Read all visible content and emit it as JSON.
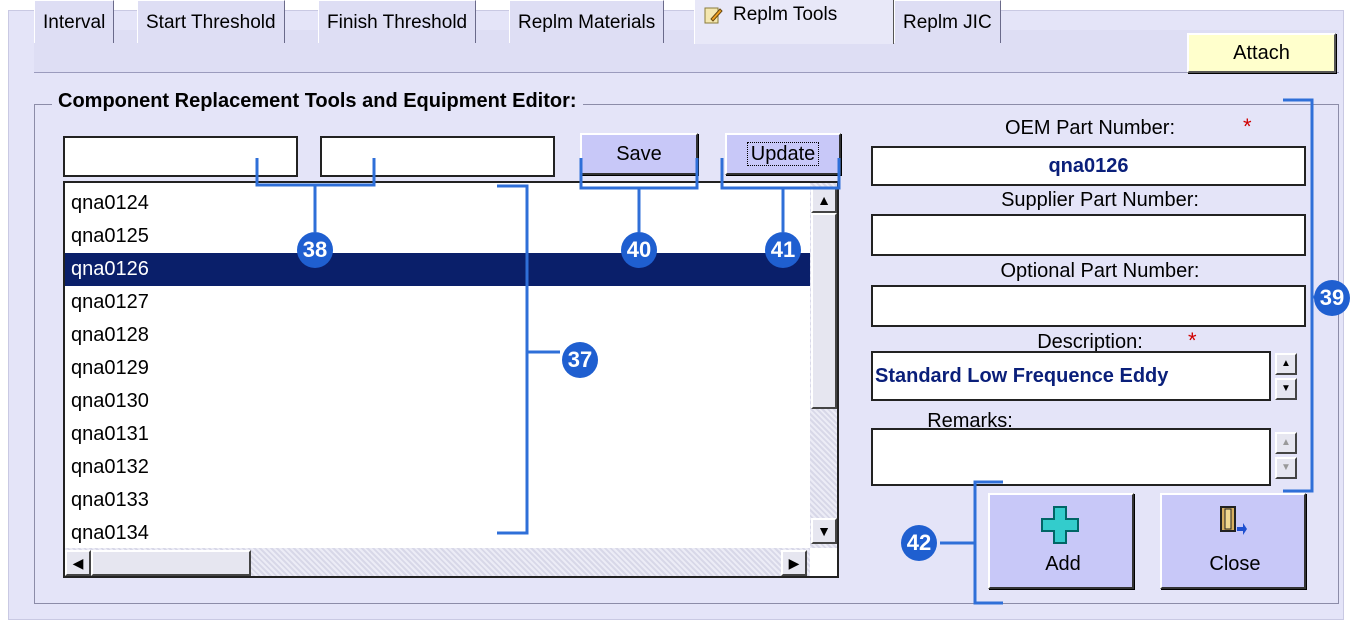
{
  "tabs": [
    {
      "label": "Interval"
    },
    {
      "label": "Start Threshold"
    },
    {
      "label": "Finish Threshold"
    },
    {
      "label": "Replm Materials"
    },
    {
      "label": "Replm Tools",
      "active": true,
      "icon": "pencil-note-icon"
    },
    {
      "label": "Replm JIC"
    }
  ],
  "attach_label": "Attach",
  "group_title": "Component Replacement Tools and Equipment Editor:",
  "filters": {
    "field1": "",
    "field2": ""
  },
  "save_label": "Save",
  "update_label": "Update",
  "list": {
    "items": [
      "qna0124",
      "qna0125",
      "qna0126",
      "qna0127",
      "qna0128",
      "qna0129",
      "qna0130",
      "qna0131",
      "qna0132",
      "qna0133",
      "qna0134"
    ],
    "selected_index": 2
  },
  "form": {
    "oem_label": "OEM Part Number:",
    "oem_value": "qna0126",
    "supplier_label": "Supplier Part Number:",
    "supplier_value": "",
    "optional_label": "Optional Part Number:",
    "optional_value": "",
    "description_label": "Description:",
    "description_value": "Standard Low Frequence Eddy",
    "remarks_label": "Remarks:",
    "remarks_value": "",
    "required_mark": "*"
  },
  "add_label": "Add",
  "close_label": "Close",
  "callouts": [
    "37",
    "38",
    "39",
    "40",
    "41",
    "42"
  ],
  "colors": {
    "accent": "#2f6fd8",
    "selection": "#0a1f6a",
    "button": "#c8c8f8",
    "attach": "#ffffcc"
  }
}
